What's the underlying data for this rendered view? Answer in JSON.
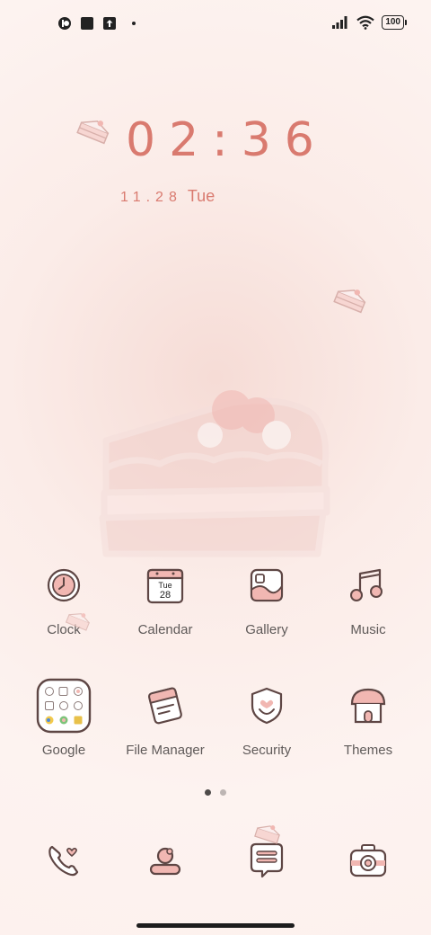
{
  "status_bar": {
    "battery": "100",
    "left_icons": [
      "notification-app-icon",
      "notification-square-icon",
      "upload-icon",
      "more-dot-icon"
    ],
    "right_icons": [
      "signal-icon",
      "wifi-icon",
      "battery-icon"
    ]
  },
  "lockclock": {
    "time": "02:36",
    "date": "11.28",
    "weekday": "Tue"
  },
  "apps": [
    {
      "label": "Clock",
      "icon": "clock-icon"
    },
    {
      "label": "Calendar",
      "icon": "calendar-icon",
      "icon_text_top": "Tue",
      "icon_text_bottom": "28"
    },
    {
      "label": "Gallery",
      "icon": "gallery-icon"
    },
    {
      "label": "Music",
      "icon": "music-icon"
    },
    {
      "label": "Google",
      "icon": "google-folder-icon"
    },
    {
      "label": "File Manager",
      "icon": "file-manager-icon"
    },
    {
      "label": "Security",
      "icon": "security-icon"
    },
    {
      "label": "Themes",
      "icon": "themes-icon"
    }
  ],
  "page_indicator": {
    "pages": 2,
    "current": 1
  },
  "dock": [
    {
      "name": "phone",
      "icon": "phone-icon"
    },
    {
      "name": "contacts",
      "icon": "contacts-icon"
    },
    {
      "name": "messages",
      "icon": "messages-icon"
    },
    {
      "name": "camera",
      "icon": "camera-icon"
    }
  ],
  "colors": {
    "accent": "#d97a6f",
    "icon_pink": "#f1b7b2",
    "icon_outline": "#5e4644",
    "label_text": "#5f5a59"
  }
}
